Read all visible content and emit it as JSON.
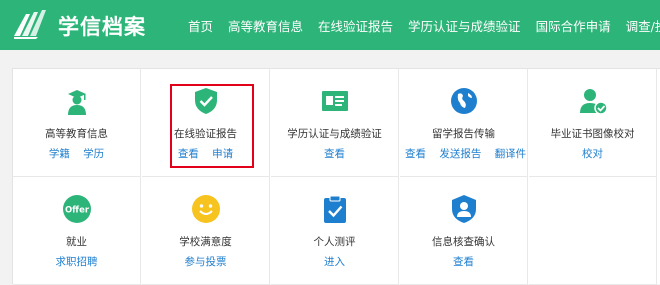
{
  "header": {
    "logo_text": "学信档案",
    "nav": [
      "首页",
      "高等教育信息",
      "在线验证报告",
      "学历认证与成绩验证",
      "国际合作申请",
      "调查/投票"
    ]
  },
  "colors": {
    "brand_green": "#2db479",
    "link_blue": "#1f7fcf",
    "highlight_red": "#e3001b"
  },
  "cells": [
    {
      "icon": "graduate-icon",
      "title": "高等教育信息",
      "links": [
        "学籍",
        "学历"
      ]
    },
    {
      "icon": "shield-check-icon",
      "title": "在线验证报告",
      "links": [
        "查看",
        "申请"
      ]
    },
    {
      "icon": "id-card-icon",
      "title": "学历认证与成绩验证",
      "links": [
        "查看"
      ]
    },
    {
      "icon": "globe-icon",
      "title": "留学报告传输",
      "links": [
        "查看",
        "发送报告",
        "翻译件"
      ]
    },
    {
      "icon": "user-check-icon",
      "title": "毕业证书图像校对",
      "links": [
        "校对"
      ]
    },
    {
      "icon": "offer-icon",
      "icon_text": "Offer",
      "title": "就业",
      "links": [
        "求职招聘"
      ]
    },
    {
      "icon": "smiley-icon",
      "title": "学校满意度",
      "links": [
        "参与投票"
      ]
    },
    {
      "icon": "checklist-icon",
      "title": "个人测评",
      "links": [
        "进入"
      ]
    },
    {
      "icon": "user-badge-icon",
      "title": "信息核查确认",
      "links": [
        "查看"
      ]
    }
  ]
}
